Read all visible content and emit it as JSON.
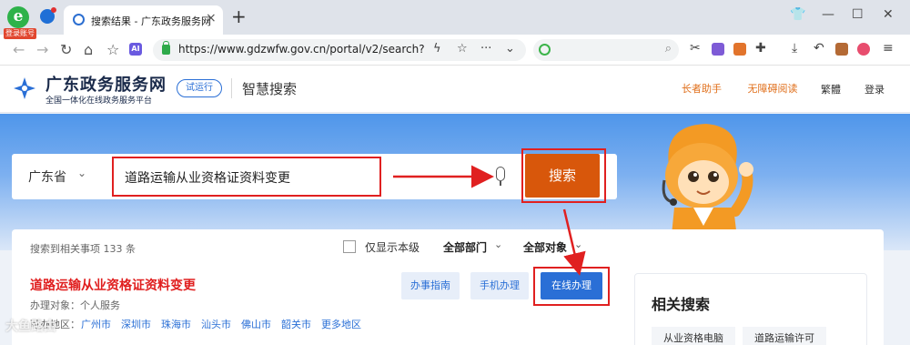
{
  "browser": {
    "login_badge": "登录账号",
    "tab_title": "搜索结果 - 广东政务服务网",
    "tab_close": "×",
    "new_tab": "+",
    "url": "https://www.gdzwfw.gov.cn/portal/v2/search?re",
    "search_engine_placeholder": "",
    "ai_badge": "AI",
    "icons": [
      "back-icon",
      "forward-icon",
      "reload-icon",
      "home-icon",
      "star-list-icon",
      "ai-icon",
      "lock-icon",
      "bolt-icon",
      "bookmark-star-icon",
      "more-icon",
      "chevron-down-icon",
      "scissors-icon",
      "translate-icon",
      "game-icon",
      "extension-icon",
      "download-icon",
      "undo-icon",
      "briefcase-icon",
      "profile-icon",
      "menu-icon"
    ],
    "window_controls": [
      "shirt-icon",
      "minimize-icon",
      "maximize-icon",
      "close-icon"
    ]
  },
  "header": {
    "site_name": "广东政务服务网",
    "site_sub": "全国一体化在线政务服务平台",
    "trial_badge": "试运行",
    "page_heading": "智慧搜索",
    "elder_mode": "长者助手",
    "accessible_read": "无障碍阅读",
    "traditional": "繁體",
    "login": "登录"
  },
  "search": {
    "region": "广东省",
    "query": "道路运输从业资格证资料变更",
    "button": "搜索"
  },
  "results": {
    "count_text": "搜索到相关事项 133 条",
    "local_only_label": "仅显示本级",
    "dept_filter": "全部部门",
    "target_filter": "全部对象",
    "item": {
      "title": "道路运输从业资格证资料变更",
      "target": "办理对象：个人服务",
      "region_label": "可办地区：",
      "regions": [
        "广州市",
        "深圳市",
        "珠海市",
        "汕头市",
        "佛山市",
        "韶关市",
        "更多地区"
      ],
      "guide_button": "办事指南",
      "mobile_button": "手机办理",
      "online_button": "在线办理"
    }
  },
  "related": {
    "title": "相关搜索",
    "tags": [
      "从业资格电脑",
      "道路运输许可"
    ]
  },
  "watermark": "大鱼路由",
  "colors": {
    "search_button": "#d8570b",
    "online_button": "#2a6fd6",
    "highlight_frame": "#e02020",
    "result_title": "#e01f1f",
    "header_accent": "#e0701d"
  }
}
